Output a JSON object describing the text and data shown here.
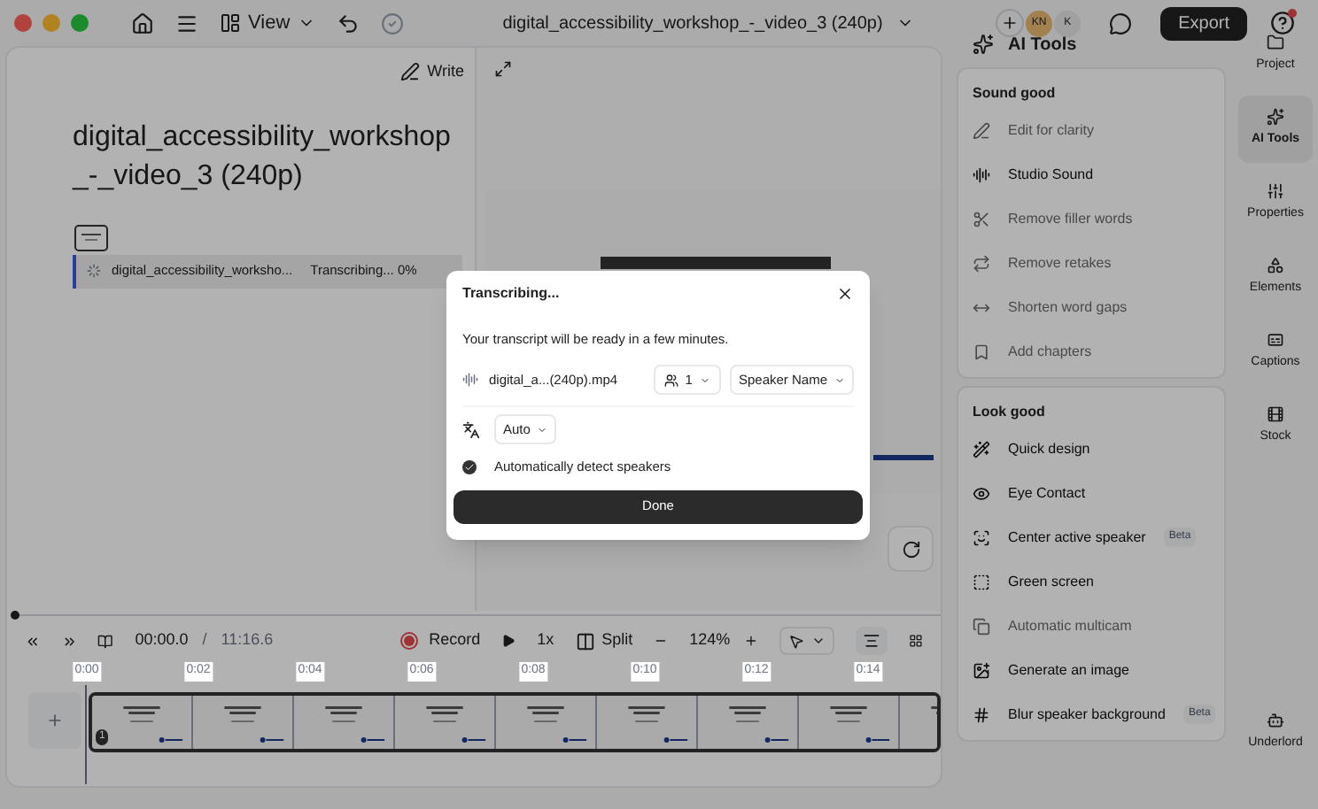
{
  "topbar": {
    "view_label": "View",
    "title": "digital_accessibility_workshop_-_video_3 (240p)",
    "avatars": [
      "KN",
      "K"
    ],
    "export_label": "Export",
    "help_notification": true
  },
  "script": {
    "write_label": "Write",
    "heading": "digital_accessibility_workshop_-_video_3 (240p)",
    "clip": {
      "name": "digital_accessibility_worksho...",
      "status": "Transcribing... 0%"
    }
  },
  "ai_tools": {
    "title": "AI Tools",
    "sections": [
      {
        "title": "Sound good",
        "items": [
          {
            "label": "Edit for clarity",
            "disabled": true
          },
          {
            "label": "Studio Sound",
            "disabled": false
          },
          {
            "label": "Remove filler words",
            "disabled": true
          },
          {
            "label": "Remove retakes",
            "disabled": true
          },
          {
            "label": "Shorten word gaps",
            "disabled": true
          },
          {
            "label": "Add chapters",
            "disabled": true
          }
        ]
      },
      {
        "title": "Look good",
        "items": [
          {
            "label": "Quick design",
            "disabled": false
          },
          {
            "label": "Eye Contact",
            "disabled": false
          },
          {
            "label": "Center active speaker",
            "disabled": false,
            "badge": "Beta"
          },
          {
            "label": "Green screen",
            "disabled": false
          },
          {
            "label": "Automatic multicam",
            "disabled": true
          },
          {
            "label": "Generate an image",
            "disabled": false
          },
          {
            "label": "Blur speaker background",
            "disabled": false,
            "badge": "Beta"
          }
        ]
      }
    ]
  },
  "rail": [
    {
      "label": "Project",
      "selected": false
    },
    {
      "label": "AI Tools",
      "selected": true
    },
    {
      "label": "Properties",
      "selected": false
    },
    {
      "label": "Elements",
      "selected": false
    },
    {
      "label": "Captions",
      "selected": false
    },
    {
      "label": "Stock",
      "selected": false
    },
    {
      "label": "Underlord",
      "selected": false
    }
  ],
  "transport": {
    "current_time": "00:00.0",
    "separator": "/",
    "total_time": "11:16.6",
    "record_label": "Record",
    "speed": "1x",
    "split_label": "Split",
    "zoom": "124%"
  },
  "timeline": {
    "ticks": [
      "0:00",
      "0:02",
      "0:04",
      "0:06",
      "0:08",
      "0:10",
      "0:12",
      "0:14"
    ],
    "track_number": "1"
  },
  "dialog": {
    "title": "Transcribing...",
    "message": "Your transcript will be ready in a few minutes.",
    "file": "digital_a...(240p).mp4",
    "speaker_count": "1",
    "speaker_name": "Speaker Name",
    "language": "Auto",
    "detect_speakers": {
      "label": "Automatically detect speakers",
      "checked": true
    },
    "done_label": "Done"
  }
}
